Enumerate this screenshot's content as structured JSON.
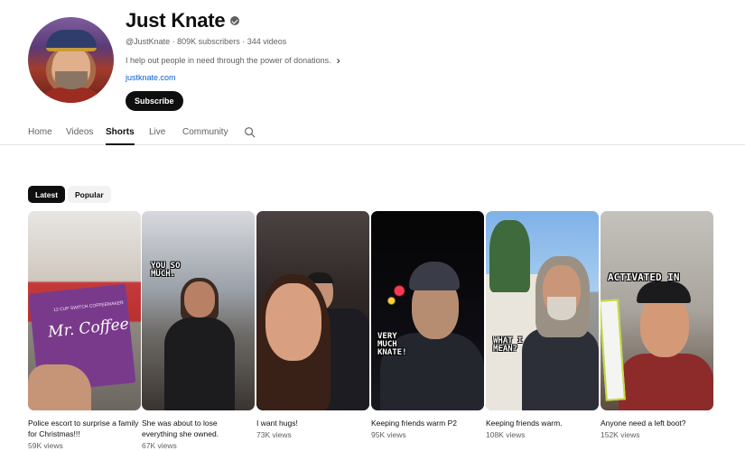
{
  "channel": {
    "name": "Just Knate",
    "meta": "@JustKnate · 809K subscribers · 344 videos",
    "description": "I help out people in need through the power of donations.",
    "link": "justknate.com",
    "subscribe_label": "Subscribe"
  },
  "tabs": [
    "Home",
    "Videos",
    "Shorts",
    "Live",
    "Community"
  ],
  "active_tab": "Shorts",
  "chips": [
    "Latest",
    "Popular"
  ],
  "active_chip": "Latest",
  "shorts": [
    {
      "title": "Police escort to surprise a family for Christmas!!!",
      "views": "59K views",
      "thumb_text": "Mr. Coffee",
      "thumb_subtext": "12 CUP SWITCH COFFEEMAKER"
    },
    {
      "title": "She was about to lose everything she owned.",
      "views": "67K views",
      "caption": "YOU SO MUCH."
    },
    {
      "title": "I want hugs!",
      "views": "73K views"
    },
    {
      "title": "Keeping friends warm P2",
      "views": "95K views",
      "caption": "VERY MUCH KNATE!"
    },
    {
      "title": "Keeping friends warm.",
      "views": "108K views",
      "caption": "WHAT I MEAN?"
    },
    {
      "title": "Anyone need a left boot?",
      "views": "152K views",
      "caption": "ACTIVATED IN"
    }
  ]
}
